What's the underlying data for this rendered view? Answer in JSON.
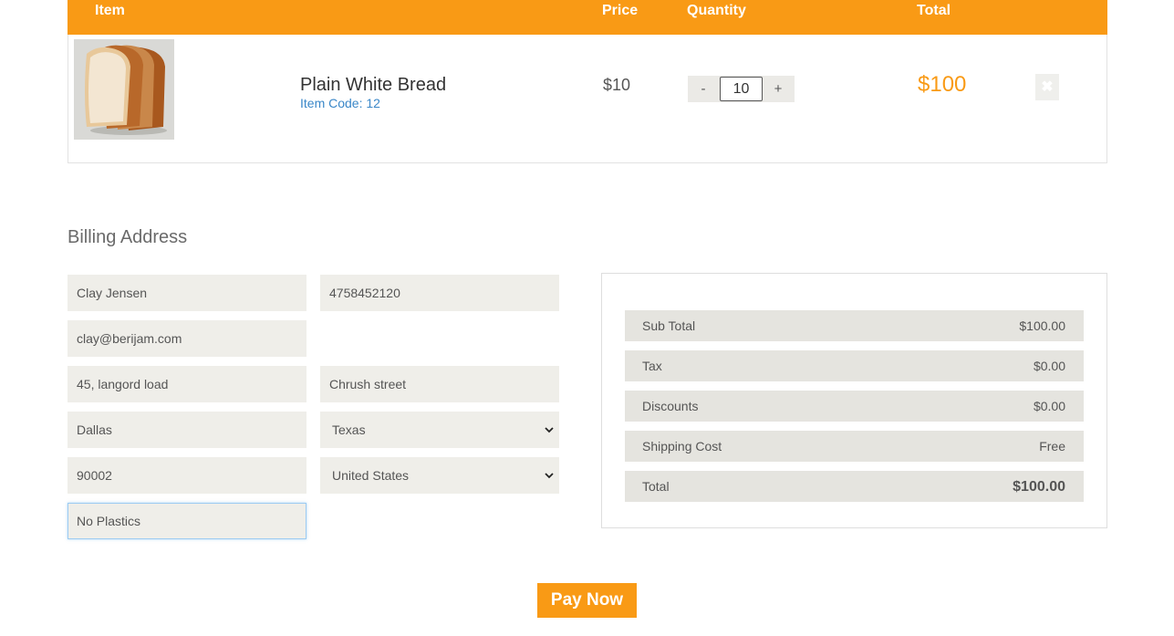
{
  "cart": {
    "headers": {
      "item": "Item",
      "price": "Price",
      "quantity": "Quantity",
      "total": "Total"
    },
    "item": {
      "name": "Plain White Bread",
      "code": "Item Code: 12",
      "price": "$10",
      "quantity": "10",
      "total": "$100",
      "minus": "-",
      "plus": "+",
      "remove_icon": "close-icon"
    }
  },
  "billing": {
    "title": "Billing Address",
    "name": "Clay Jensen",
    "phone": "4758452120",
    "email": "clay@berijam.com",
    "address1": "45, langord load",
    "address2": "Chrush street",
    "city": "Dallas",
    "state": "Texas",
    "zip": "90002",
    "country": "United States",
    "notes": "No Plastics"
  },
  "summary": {
    "rows": [
      {
        "label": "Sub Total",
        "value": "$100.00"
      },
      {
        "label": "Tax",
        "value": "$0.00"
      },
      {
        "label": "Discounts",
        "value": "$0.00"
      },
      {
        "label": "Shipping Cost",
        "value": "Free"
      },
      {
        "label": "Total",
        "value": "$100.00"
      }
    ]
  },
  "pay_button": "Pay Now",
  "colors": {
    "accent": "#f99a15",
    "link": "#3a87c8",
    "field_bg": "#efeee9",
    "summary_row_bg": "#e5e4df"
  }
}
